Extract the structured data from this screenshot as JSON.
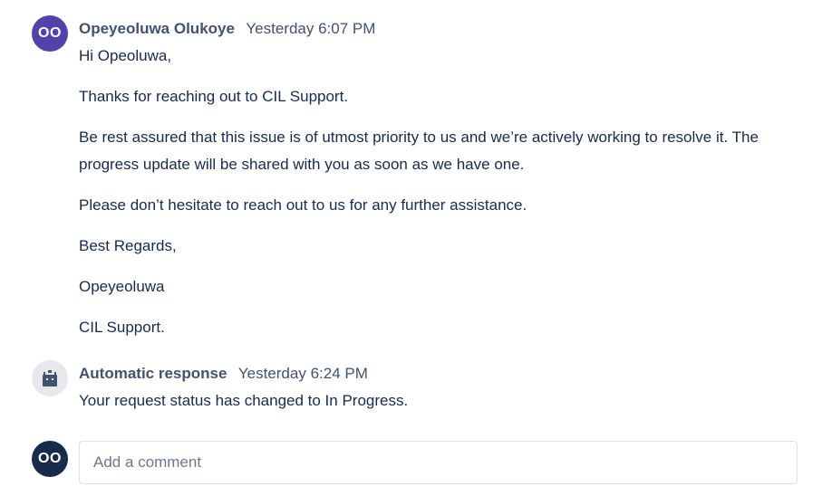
{
  "comments": [
    {
      "avatar_initials": "OO",
      "author": "Opeyeoluwa Olukoye",
      "timestamp": "Yesterday 6:07 PM",
      "paragraphs": [
        "Hi Opeoluwa,",
        "Thanks for reaching out to CIL Support.",
        "Be rest assured that this issue is of utmost priority to us and we’re actively working to resolve it. The progress update will be shared with you as soon as we have one.",
        "Please don’t hesitate to reach out to us for any further assistance.",
        "Best Regards,",
        "Opeyeoluwa",
        "CIL Support."
      ]
    },
    {
      "avatar_icon": "bot-icon",
      "author": "Automatic response",
      "timestamp": "Yesterday 6:24 PM",
      "text": "Your request status has changed to In Progress."
    }
  ],
  "composer": {
    "avatar_initials": "OO",
    "placeholder": "Add a comment"
  },
  "colors": {
    "author_avatar": "#5243aa",
    "user_avatar": "#172b4d",
    "bot_avatar_bg": "#e6e8ec",
    "meta_text": "#42526e",
    "body_text": "#172b4d"
  }
}
